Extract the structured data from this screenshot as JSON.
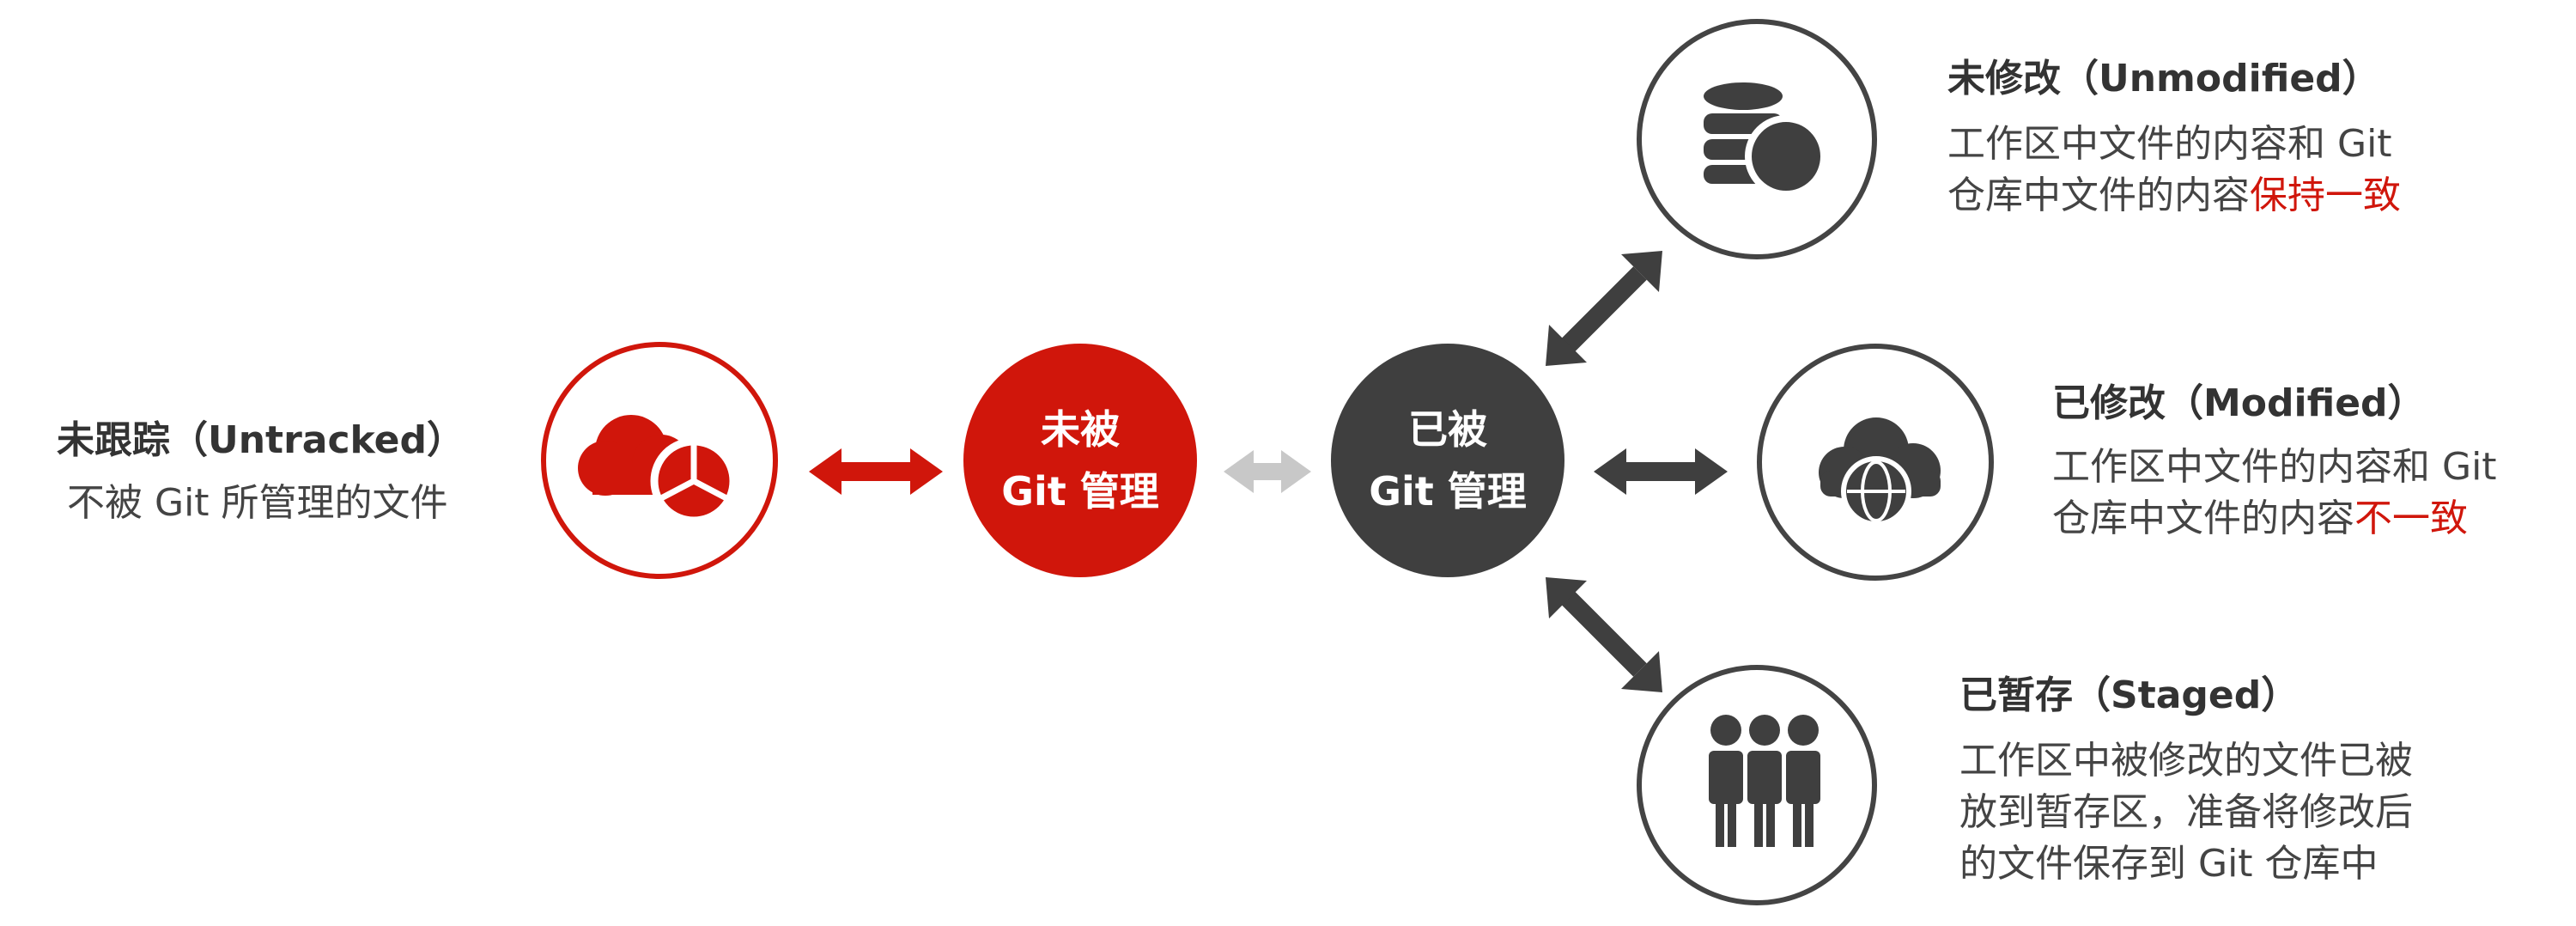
{
  "untracked": {
    "title": "未跟踪（Untracked）",
    "desc": "不被 Git 所管理的文件"
  },
  "not_managed": {
    "line1": "未被",
    "line2": "Git 管理"
  },
  "managed": {
    "line1": "已被",
    "line2": "Git 管理"
  },
  "unmodified": {
    "title": "未修改（Unmodified）",
    "desc_line1": "工作区中文件的内容和 Git",
    "desc_line2": "仓库中文件的内容",
    "desc_highlight": "保持一致"
  },
  "modified": {
    "title": "已修改（Modified）",
    "desc_line1": "工作区中文件的内容和 Git",
    "desc_line2": "仓库中文件的内容",
    "desc_highlight": "不一致"
  },
  "staged": {
    "title": "已暂存（Staged）",
    "desc_line1": "工作区中被修改的文件已被",
    "desc_line2": "放到暂存区，准备将修改后",
    "desc_line3": "的文件保存到 Git 仓库中"
  },
  "colors": {
    "accent_red": "#d0160b",
    "dark_gray": "#3f3f3f",
    "light_gray": "#c8c8c8",
    "text": "#333333"
  },
  "icons": {
    "untracked": "cloud-pie-chart-icon",
    "unmodified": "database-icon",
    "modified": "cloud-globe-icon",
    "staged": "team-icon"
  }
}
